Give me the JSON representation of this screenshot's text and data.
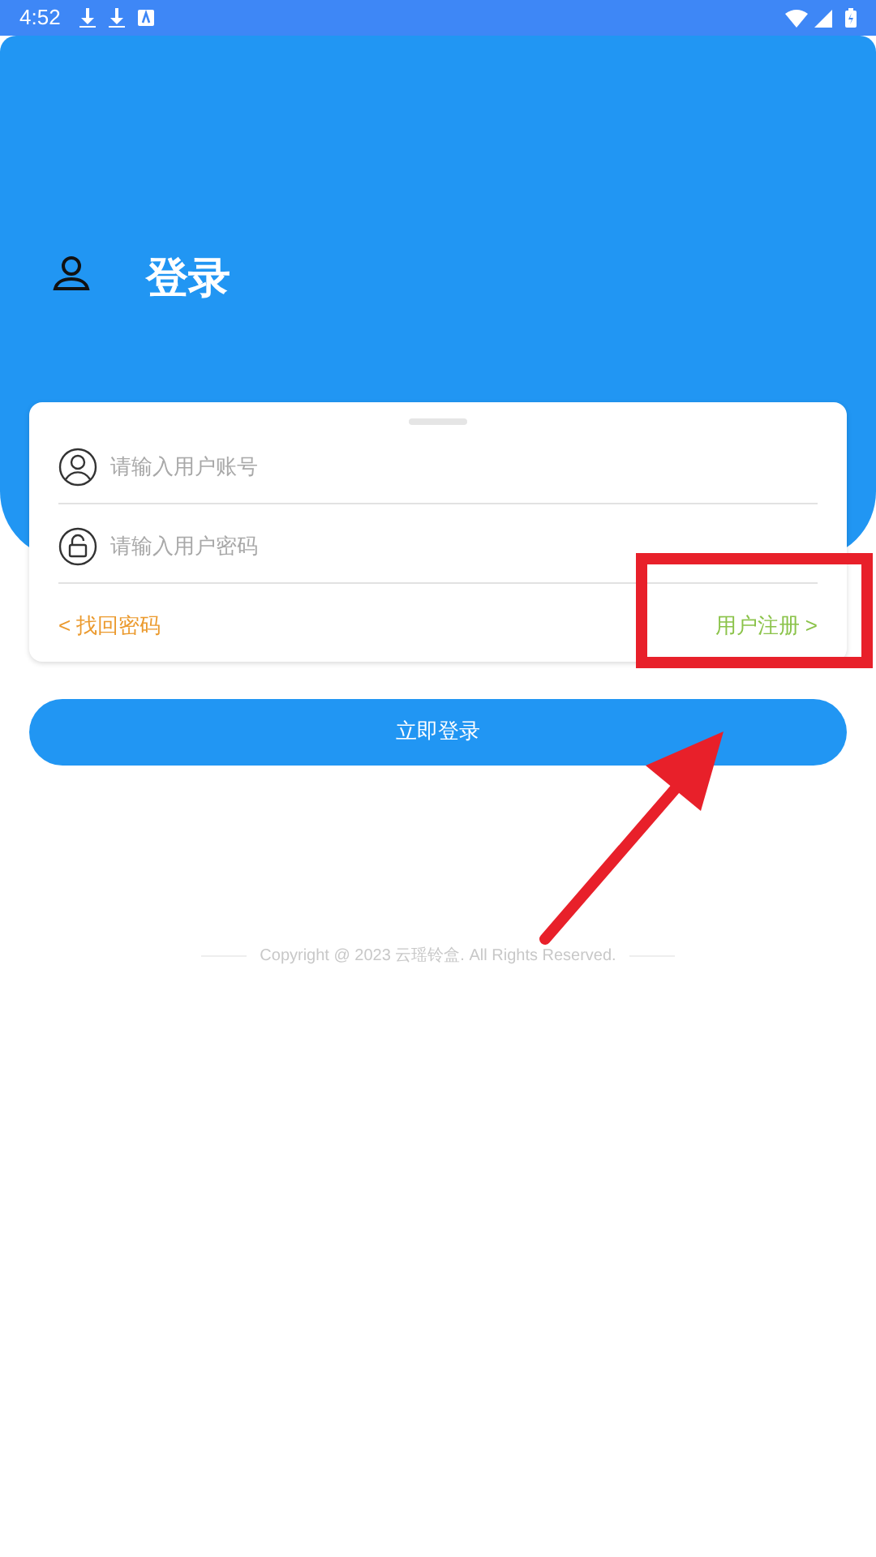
{
  "status_bar": {
    "time": "4:52"
  },
  "header": {
    "title": "登录"
  },
  "form": {
    "fields": [
      {
        "kind": "account",
        "placeholder": "请输入用户账号"
      },
      {
        "kind": "password",
        "placeholder": "请输入用户密码"
      }
    ],
    "links": [
      {
        "kind": "forgot",
        "label": "< 找回密码"
      },
      {
        "kind": "register",
        "label": "用户注册 >"
      }
    ]
  },
  "login_button": "立即登录",
  "copyright": "Copyright @ 2023 云瑶铃盒. All Rights Reserved."
}
